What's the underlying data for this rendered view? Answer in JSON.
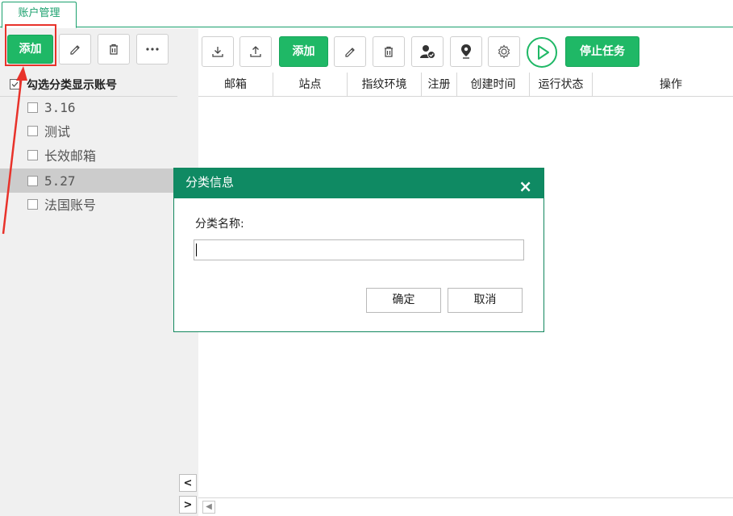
{
  "tab": {
    "title": "账户管理"
  },
  "left_toolbar": {
    "add_label": "添加"
  },
  "left_list": {
    "header": "勾选分类显示账号",
    "items": [
      "3.16",
      "测试",
      "长效邮箱",
      "5.27",
      "法国账号"
    ],
    "selected_index": 3
  },
  "right_toolbar": {
    "add_label": "添加",
    "stop_label": "停止任务"
  },
  "columns": [
    "邮箱",
    "站点",
    "指纹环境",
    "注册",
    "创建时间",
    "运行状态",
    "操作"
  ],
  "dialog": {
    "title": "分类信息",
    "close": "×",
    "field_label": "分类名称:",
    "input_value": "",
    "ok_label": "确定",
    "cancel_label": "取消"
  },
  "scroll": {
    "left_arrow": "<",
    "right_arrow": ">"
  },
  "colors": {
    "accent": "#1fb866",
    "dialog_title": "#0f8a63",
    "highlight": "#e8322a"
  }
}
